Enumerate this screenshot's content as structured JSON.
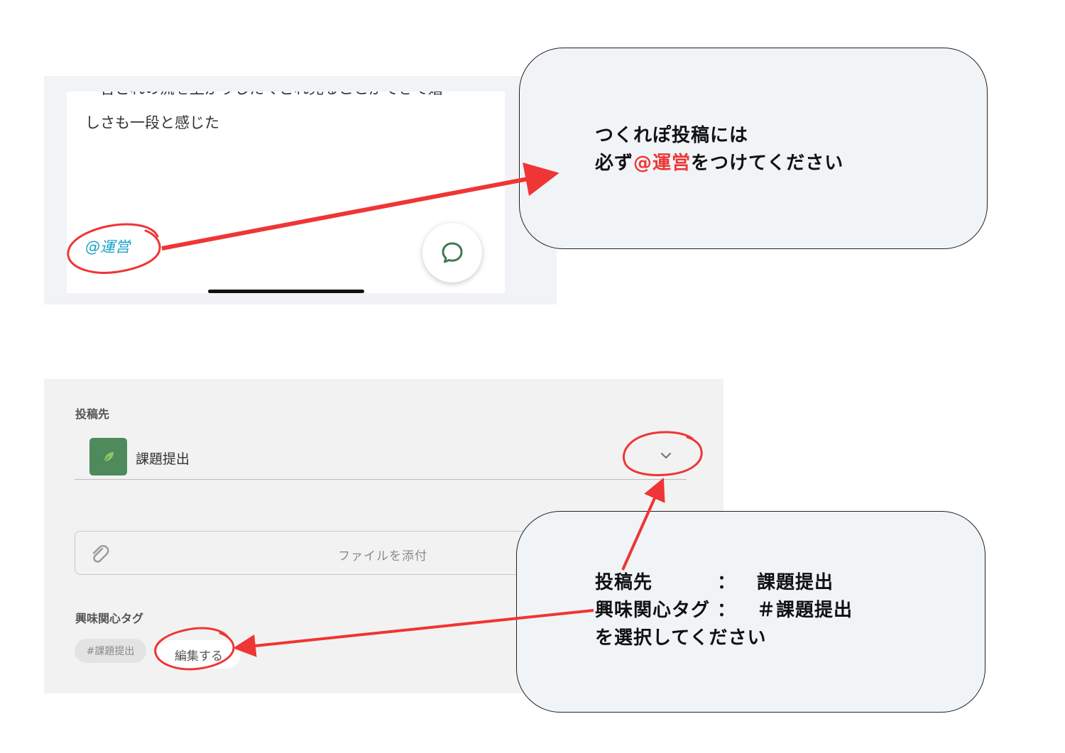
{
  "post": {
    "cut_text": "一言どれの流を上がりしたくどれ見ることができて嬉",
    "text": "しさも一段と感じた",
    "mention": "@運営"
  },
  "callout_top": {
    "line1": "つくれぽ投稿には",
    "line2_pre": "必ず",
    "line2_mention": "@運営",
    "line2_post": "をつけてください"
  },
  "form": {
    "destination_label": "投稿先",
    "destination_value": "課題提出",
    "attach_label": "ファイルを添付",
    "tags_label": "興味関心タグ",
    "tag_chip": "#課題提出",
    "edit_button": "編集する"
  },
  "callout_bottom": {
    "row1_label": "投稿先",
    "row1_sep": "：",
    "row1_value": "課題提出",
    "row2_label": "興味関心タグ",
    "row2_sep": "：",
    "row2_value": "＃課題提出",
    "row3": "を選択してください"
  },
  "colors": {
    "annotation_red": "#ef3535",
    "mention_blue": "#1aa3c6",
    "channel_green": "#4e8a5c"
  },
  "icons": [
    "comment-bubble-icon",
    "leaf-icon",
    "chevron-down-icon",
    "paperclip-icon"
  ]
}
